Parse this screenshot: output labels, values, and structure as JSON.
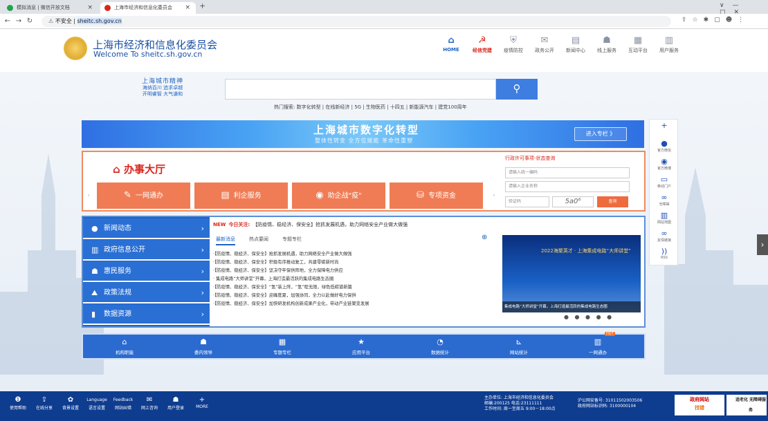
{
  "browser": {
    "tabs": [
      {
        "title": "模拟消息 | 微信开放文档",
        "active": false
      },
      {
        "title": "上海市经济和信息化委员会",
        "active": true
      }
    ],
    "new_tab": "+",
    "url_warning": "不安全",
    "url": "sheitc.sh.gov.cn",
    "win_controls": [
      "∨",
      "—",
      "□",
      "✕"
    ]
  },
  "header": {
    "title": "上海市经济和信息化委员会",
    "subtitle": "Welcome To sheitc.sh.gov.cn",
    "nav": [
      {
        "label": "HOME",
        "icon": "home-icon",
        "glyph": "⌂",
        "style": "home"
      },
      {
        "label": "经信党建",
        "icon": "party-icon",
        "glyph": "☭",
        "style": "red"
      },
      {
        "label": "疫情防控",
        "icon": "shield-icon",
        "glyph": "⛨",
        "style": ""
      },
      {
        "label": "政务公开",
        "icon": "chat-icon",
        "glyph": "✉",
        "style": ""
      },
      {
        "label": "新闻中心",
        "icon": "news-icon",
        "glyph": "▤",
        "style": ""
      },
      {
        "label": "线上服务",
        "icon": "users-icon",
        "glyph": "☗",
        "style": ""
      },
      {
        "label": "互动平台",
        "icon": "grid-icon",
        "glyph": "▦",
        "style": ""
      },
      {
        "label": "用户服务",
        "icon": "building-icon",
        "glyph": "▥",
        "style": ""
      }
    ]
  },
  "spirit": {
    "title": "上海城市精神",
    "line1": "海纳百川 追求卓越",
    "line2": "开明睿智 大气谦和"
  },
  "search": {
    "placeholder": "",
    "hot": "热门搜索: 数字化转型 | 在线新经济 | 5G | 生物医药 | 十四五 | 新能源汽车 | 建党100周年"
  },
  "banner": {
    "title": "上海城市数字化转型",
    "subtitle": "整体性转变 全方位赋能 革命性重塑",
    "button": "进入专栏 》"
  },
  "hall": {
    "title": "办事大厅",
    "services": [
      {
        "label": "一网通办",
        "glyph": "✎"
      },
      {
        "label": "利企服务",
        "glyph": "▤"
      },
      {
        "label": "助企战\"疫\"",
        "glyph": "◉"
      },
      {
        "label": "专项资金",
        "glyph": "⛁"
      }
    ],
    "query": {
      "title": "行政许可事项-状态查询",
      "code_placeholder": "请输入统一编码",
      "name_placeholder": "请输入企业名称",
      "captcha_placeholder": "验证码",
      "captcha": "5a0⁶",
      "button": "查询"
    }
  },
  "news": {
    "menu": [
      {
        "label": "新闻动态",
        "glyph": "●"
      },
      {
        "label": "政府信息公开",
        "glyph": "▥"
      },
      {
        "label": "惠民服务",
        "glyph": "☗"
      },
      {
        "label": "政策法规",
        "glyph": "⛰"
      },
      {
        "label": "数据资源",
        "glyph": "▮"
      }
    ],
    "focus_tag": "今日关注:",
    "focus": "【防疫情、稳经济、保安全】抢抓发展机遇，助力网络安全产业做大做强",
    "tabs": [
      "最新消息",
      "热点要闻",
      "专题专栏"
    ],
    "items": [
      "·【防疫情、稳经济、保安全】抢抓发展机遇，助力网络安全产业做大做强",
      "·【防疫情、稳经济、保安全】积极有序推动复工，共建零碳新时尚",
      "·【防疫情、稳经济、保安全】坚决守牢保供阵地，全力保障电力供应",
      "· 集成电路“大师讲堂”开幕，上海打造最活跃的集成电路生态圈",
      "·【防疫情、稳经济、保安全】“氢”装上阵，“氢”程无限，绿色低碳谱新篇",
      "·【防疫情、稳经济、保安全】迎峰度夏，加强协同，全力以赴做好电力保供",
      "·【防疫情、稳经济、保安全】加快研发机构创新成果产业化，带动产业链聚变发展"
    ],
    "photo_headline": "2022海聚英才 · 上海集成电路“大师讲堂”",
    "photo_caption": "集成电路“大师讲堂”开幕，上海打造最活跃的集成电路生态圈",
    "dots": "● ● ● ● ●"
  },
  "quick": [
    {
      "label": "机构职能",
      "glyph": "⌂"
    },
    {
      "label": "委内领导",
      "glyph": "☗"
    },
    {
      "label": "专题专栏",
      "glyph": "▦"
    },
    {
      "label": "应用平台",
      "glyph": "★"
    },
    {
      "label": "数据统计",
      "glyph": "◔"
    },
    {
      "label": "网站统计",
      "glyph": "⊾"
    },
    {
      "label": "一网通办",
      "glyph": "▥",
      "badge": "HOT"
    }
  ],
  "float": [
    {
      "label": "",
      "glyph": "+"
    },
    {
      "label": "官方微信",
      "glyph": "●"
    },
    {
      "label": "官方微博",
      "glyph": "◉"
    },
    {
      "label": "移动门户",
      "glyph": "▭"
    },
    {
      "label": "无障碍",
      "glyph": "∞"
    },
    {
      "label": "网站地图",
      "glyph": "▥"
    },
    {
      "label": "友情链接",
      "glyph": "∞"
    },
    {
      "label": "RSS",
      "glyph": "))"
    }
  ],
  "footer": {
    "tools": [
      {
        "label": "使用帮助",
        "glyph": "❶"
      },
      {
        "label": "在线分享",
        "glyph": "⇪"
      },
      {
        "label": "背景设置",
        "glyph": "✿"
      },
      {
        "label": "语言设置",
        "glyph": "Language"
      },
      {
        "label": "网站纠错",
        "glyph": "Feedback"
      },
      {
        "label": "网上咨询",
        "glyph": "✉"
      },
      {
        "label": "用户登录",
        "glyph": "☗"
      },
      {
        "label": "MORE",
        "glyph": "+"
      }
    ],
    "host": "主办单位: 上海市经济和信息化委员会",
    "postal": "邮编:200125 电话:23111111",
    "hours": "工作时间: 周一至周五 9:00－18:00点",
    "police": "沪公网安备号: 31011502003506",
    "icp": "政府网站标识码: 3100000104",
    "gov_site": "政府网站",
    "gov_error": "找错",
    "access": "适老化 无障碍服务"
  }
}
